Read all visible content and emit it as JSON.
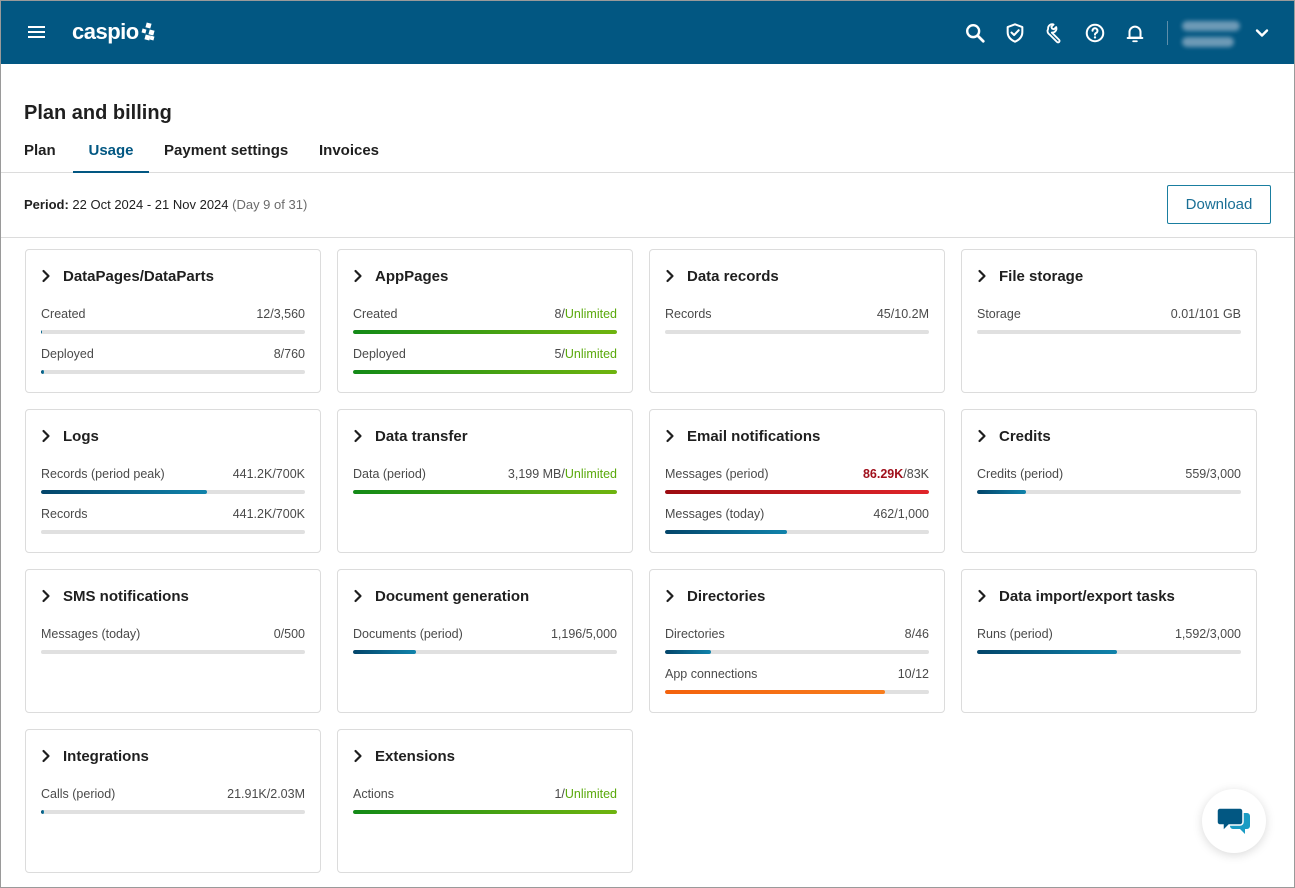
{
  "header": {
    "brand": "caspio",
    "icons": [
      "search-icon",
      "shield-check-icon",
      "wrench-icon",
      "help-icon",
      "bell-icon"
    ],
    "user_menu": "chevron-down-icon"
  },
  "page": {
    "title": "Plan and billing",
    "tabs": [
      {
        "label": "Plan",
        "active": false
      },
      {
        "label": "Usage",
        "active": true
      },
      {
        "label": "Payment settings",
        "active": false
      },
      {
        "label": "Invoices",
        "active": false
      }
    ],
    "period_label": "Period:",
    "period_range": " 22 Oct 2024 - 21 Nov 2024 ",
    "period_day": "(Day 9 of 31)",
    "download_label": "Download"
  },
  "colors": {
    "brand": "#025782",
    "unlimited": "#5aaa0c",
    "over_limit": "#a0101c",
    "warning": "#f4620c"
  },
  "cards": [
    {
      "title": "DataPages/DataParts",
      "metrics": [
        {
          "label": "Created",
          "used": "12",
          "limit": "3,560",
          "percent": 0.34,
          "style": "blue"
        },
        {
          "label": "Deployed",
          "used": "8",
          "limit": "760",
          "percent": 1.05,
          "style": "blue"
        }
      ]
    },
    {
      "title": "AppPages",
      "metrics": [
        {
          "label": "Created",
          "used": "8",
          "limit": "Unlimited",
          "percent": 100,
          "style": "green"
        },
        {
          "label": "Deployed",
          "used": "5",
          "limit": "Unlimited",
          "percent": 100,
          "style": "green"
        }
      ]
    },
    {
      "title": "Data records",
      "metrics": [
        {
          "label": "Records",
          "used": "45",
          "limit": "10.2M",
          "percent": 0,
          "style": "blue"
        }
      ]
    },
    {
      "title": "File storage",
      "metrics": [
        {
          "label": "Storage",
          "used": "0.01",
          "limit": "101 GB",
          "percent": 0,
          "style": "blue"
        }
      ]
    },
    {
      "title": "Logs",
      "metrics": [
        {
          "label": "Records (period peak)",
          "used": "441.2K",
          "limit": "700K",
          "percent": 63,
          "style": "blue"
        },
        {
          "label": "Records",
          "used": "441.2K",
          "limit": "700K",
          "percent": 0,
          "style": "blue"
        }
      ]
    },
    {
      "title": "Data transfer",
      "metrics": [
        {
          "label": "Data (period)",
          "used": "3,199 MB",
          "limit": "Unlimited",
          "percent": 100,
          "style": "green"
        }
      ]
    },
    {
      "title": "Email notifications",
      "metrics": [
        {
          "label": "Messages (period)",
          "used": "86.29K",
          "limit": "83K",
          "percent": 100,
          "style": "red",
          "over": true
        },
        {
          "label": "Messages (today)",
          "used": "462",
          "limit": "1,000",
          "percent": 46.2,
          "style": "blue"
        }
      ]
    },
    {
      "title": "Credits",
      "metrics": [
        {
          "label": "Credits (period)",
          "used": "559",
          "limit": "3,000",
          "percent": 18.6,
          "style": "blue"
        }
      ]
    },
    {
      "title": "SMS notifications",
      "metrics": [
        {
          "label": "Messages (today)",
          "used": "0",
          "limit": "500",
          "percent": 0,
          "style": "blue"
        }
      ]
    },
    {
      "title": "Document generation",
      "metrics": [
        {
          "label": "Documents (period)",
          "used": "1,196",
          "limit": "5,000",
          "percent": 23.9,
          "style": "blue"
        }
      ]
    },
    {
      "title": "Directories",
      "metrics": [
        {
          "label": "Directories",
          "used": "8",
          "limit": "46",
          "percent": 17.4,
          "style": "blue"
        },
        {
          "label": "App connections",
          "used": "10",
          "limit": "12",
          "percent": 83.3,
          "style": "orange"
        }
      ]
    },
    {
      "title": "Data import/export tasks",
      "metrics": [
        {
          "label": "Runs (period)",
          "used": "1,592",
          "limit": "3,000",
          "percent": 53.1,
          "style": "blue"
        }
      ]
    },
    {
      "title": "Integrations",
      "metrics": [
        {
          "label": "Calls (period)",
          "used": "21.91K",
          "limit": "2.03M",
          "percent": 1.08,
          "style": "blue"
        }
      ]
    },
    {
      "title": "Extensions",
      "metrics": [
        {
          "label": "Actions",
          "used": "1",
          "limit": "Unlimited",
          "percent": 100,
          "style": "green"
        }
      ]
    }
  ]
}
